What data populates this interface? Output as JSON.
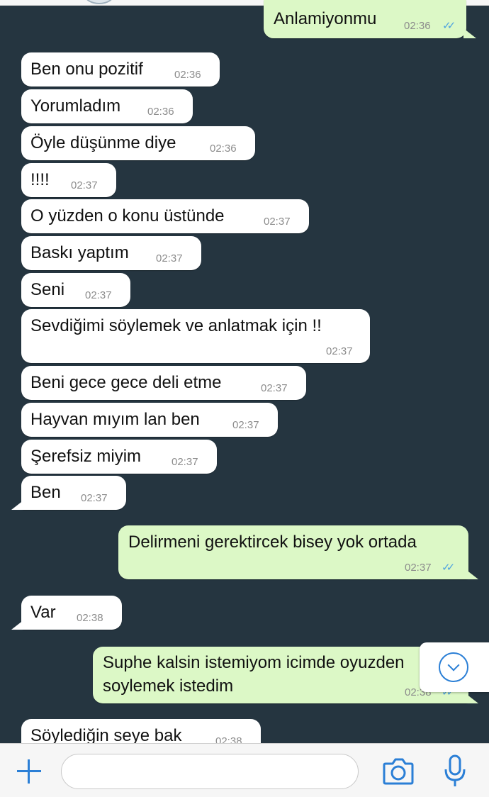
{
  "messages": [
    {
      "dir": "out",
      "text": "Anlamiyonmu",
      "time": "02:36",
      "read": true
    },
    {
      "dir": "in",
      "text": "Ben onu pozitif",
      "time": "02:36"
    },
    {
      "dir": "in",
      "text": "Yorumladım",
      "time": "02:36"
    },
    {
      "dir": "in",
      "text": "Öyle düşünme diye",
      "time": "02:36"
    },
    {
      "dir": "in",
      "text": "!!!!",
      "time": "02:37"
    },
    {
      "dir": "in",
      "text": "O yüzden o konu üstünde",
      "time": "02:37"
    },
    {
      "dir": "in",
      "text": "Baskı yaptım",
      "time": "02:37"
    },
    {
      "dir": "in",
      "text": "Seni",
      "time": "02:37"
    },
    {
      "dir": "in",
      "text": "Sevdiğimi söylemek ve anlatmak için !!",
      "time": "02:37"
    },
    {
      "dir": "in",
      "text": "Beni gece gece deli etme",
      "time": "02:37"
    },
    {
      "dir": "in",
      "text": "Hayvan mıyım lan ben",
      "time": "02:37"
    },
    {
      "dir": "in",
      "text": "Şerefsiz miyim",
      "time": "02:37"
    },
    {
      "dir": "in",
      "text": "Ben",
      "time": "02:37"
    },
    {
      "dir": "out",
      "text": "Delirmeni gerektircek bisey yok ortada",
      "time": "02:37",
      "read": true
    },
    {
      "dir": "in",
      "text": "Var",
      "time": "02:38"
    },
    {
      "dir": "out",
      "text": "Suphe kalsin istemiyom icimde oyuzden",
      "text2": "soylemek istedim",
      "time": "02:38",
      "read": true
    },
    {
      "dir": "in",
      "text": "Söylediğin seye bak",
      "time": "02:38"
    }
  ],
  "input": {
    "placeholder": "",
    "value": ""
  },
  "icons": {
    "attach": "plus-icon",
    "camera": "camera-icon",
    "mic": "microphone-icon",
    "scroll": "chevron-down-icon"
  },
  "colors": {
    "background": "#253540",
    "incoming": "#ffffff",
    "outgoing": "#dcf8c6",
    "accent": "#2b7fd6",
    "read_tick": "#4fa3e0"
  }
}
